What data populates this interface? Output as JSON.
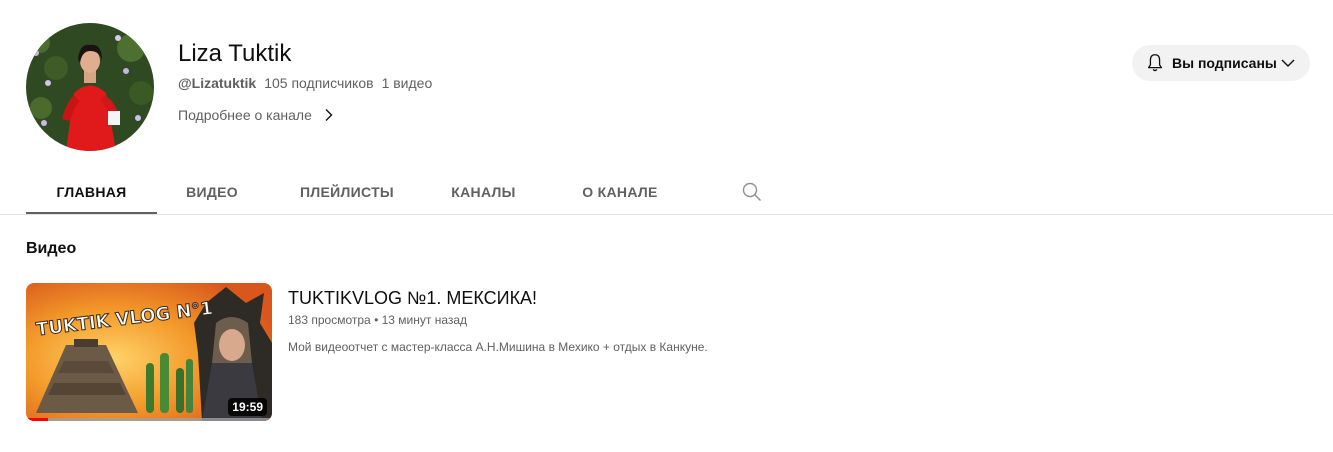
{
  "channel": {
    "title": "Liza Tuktik",
    "handle": "@Lizatuktik",
    "subscribers": "105 подписчиков",
    "video_count": "1 видео",
    "about_link": "Подробнее о канале"
  },
  "subscribe": {
    "label": "Вы подписаны",
    "icon": "bell-icon",
    "bg_color": "#f2f2f2"
  },
  "tabs": [
    {
      "label": "ГЛАВНАЯ",
      "active": true
    },
    {
      "label": "ВИДЕО",
      "active": false
    },
    {
      "label": "ПЛЕЙЛИСТЫ",
      "active": false
    },
    {
      "label": "КАНАЛЫ",
      "active": false
    },
    {
      "label": "О КАНАЛЕ",
      "active": false
    }
  ],
  "section": {
    "title": "Видео"
  },
  "video": {
    "title": "TUKTIKVLOG №1. МЕКСИКА!",
    "views": "183 просмотра",
    "separator": "•",
    "age": "13 минут назад",
    "description": "Мой видеоотчет с мастер-класса А.Н.Мишина в Мехико + отдых в Канкуне.",
    "duration": "19:59",
    "thumbnail_text": "TUKTIK VLOG N°1",
    "watched_fraction": 0.09
  },
  "colors": {
    "accent": "#ff0000",
    "text_primary": "#0f0f0f",
    "text_secondary": "#606060"
  }
}
